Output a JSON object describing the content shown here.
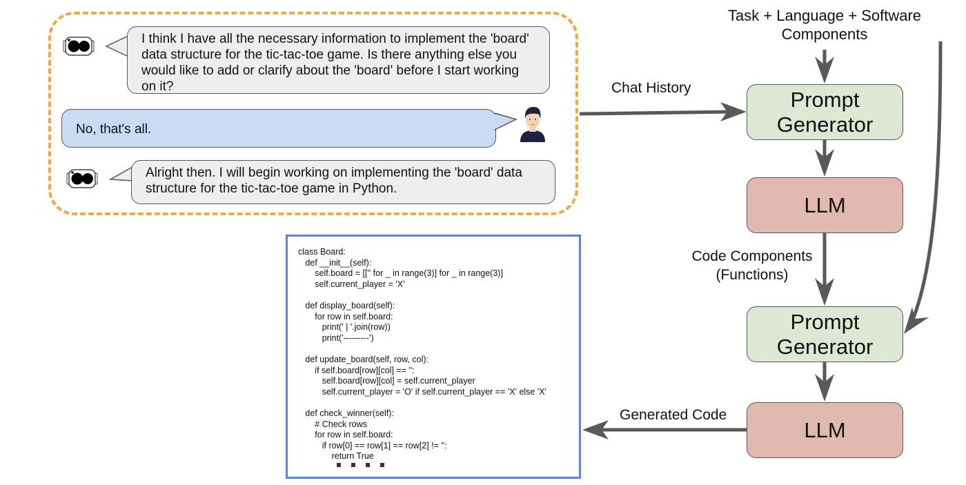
{
  "chat": {
    "messages": [
      {
        "role": "assistant",
        "avatar": "robot-icon",
        "text": "I think I have all the necessary information to implement the 'board' data structure for the tic-tac-toe game. Is there anything else you would like to add or clarify about the 'board' before I start working on it?"
      },
      {
        "role": "user",
        "avatar": "person-icon",
        "text": "No, that's all."
      },
      {
        "role": "assistant",
        "avatar": "robot-icon",
        "text": "Alright then. I will begin working on implementing the 'board' data structure for the tic-tac-toe game in Python."
      }
    ],
    "frame_color": "#f2a844",
    "assistant_bubble_color": "#eeeeee",
    "user_bubble_color": "#c9daf3"
  },
  "pipeline": {
    "input_label": "Task + Language + Software Components",
    "chat_history_label": "Chat History",
    "code_components_label": "Code Components (Functions)",
    "generated_code_label": "Generated Code",
    "nodes": [
      {
        "id": "prompt-generator-1",
        "label": "Prompt Generator",
        "color": "#dde8d4"
      },
      {
        "id": "llm-1",
        "label": "LLM",
        "color": "#e2b9ae"
      },
      {
        "id": "prompt-generator-2",
        "label": "Prompt Generator",
        "color": "#dde8d4"
      },
      {
        "id": "llm-2",
        "label": "LLM",
        "color": "#e2b9ae"
      }
    ],
    "arrow_color": "#595959"
  },
  "code": {
    "border_color": "#5b84d6",
    "lines": [
      "class Board:",
      "    def __init__(self):",
      "        self.board = [['' for _ in range(3)] for _ in range(3)]",
      "        self.current_player = 'X'",
      "",
      "    def display_board(self):",
      "        for row in self.board:",
      "            print(' | '.join(row))",
      "            print('---------')",
      "",
      "    def update_board(self, row, col):",
      "        if self.board[row][col] == '':",
      "            self.board[row][col] = self.current_player",
      "            self.current_player = 'O' if self.current_player == 'X' else 'X'",
      "",
      "    def check_winner(self):",
      "        # Check rows",
      "        for row in self.board:",
      "            if row[0] == row[1] == row[2] != '':",
      "                return True"
    ],
    "ellipsis": "...."
  }
}
